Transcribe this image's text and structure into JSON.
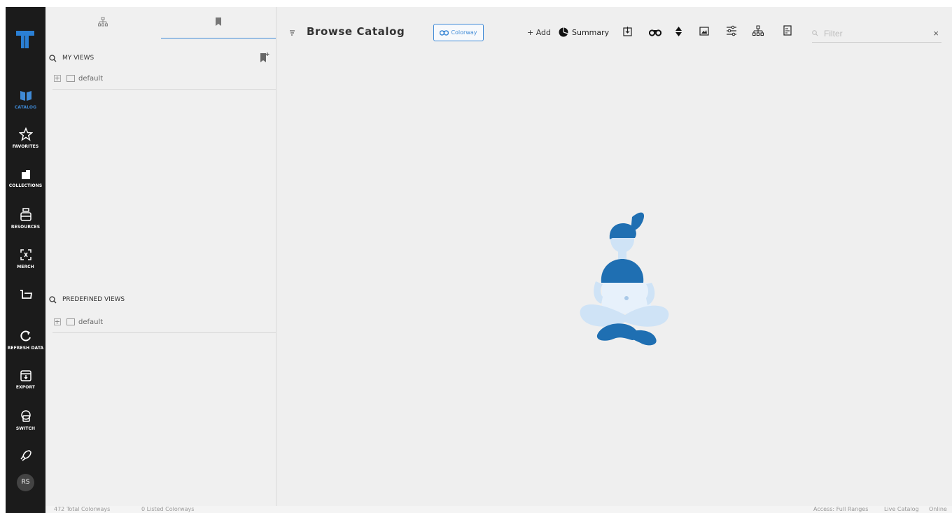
{
  "rail": {
    "items": [
      {
        "label": "CATALOG",
        "icon": "catalog-icon",
        "active": true
      },
      {
        "label": "FAVORITES",
        "icon": "star-icon"
      },
      {
        "label": "COLLECTIONS",
        "icon": "collections-icon"
      },
      {
        "label": "RESOURCES",
        "icon": "resources-icon"
      },
      {
        "label": "MERCH",
        "icon": "merch-icon"
      },
      {
        "label": "",
        "icon": "basket-icon"
      },
      {
        "label": "REFRESH DATA",
        "icon": "refresh-icon"
      },
      {
        "label": "EXPORT",
        "icon": "export-icon"
      },
      {
        "label": "SWITCH",
        "icon": "switch-icon"
      },
      {
        "label": "",
        "icon": "rocket-icon"
      }
    ],
    "avatar": "RS",
    "accent": "#3f8ad6"
  },
  "panel": {
    "my_views": {
      "title": "MY VIEWS",
      "items": [
        {
          "label": "default"
        }
      ]
    },
    "predefined_views": {
      "title": "PREDEFINED VIEWS",
      "items": [
        {
          "label": "default"
        }
      ]
    }
  },
  "toolbar": {
    "title": "Browse Catalog",
    "colorway_label": "Colorway",
    "add_label": "+ Add",
    "summary_label": "Summary",
    "filter_placeholder": "Filter",
    "close_symbol": "×"
  },
  "statusbar": {
    "total": "472 Total Colorways",
    "listed": "0 Listed Colorways",
    "access": "Access: Full Ranges",
    "catalog": "Live Catalog",
    "status": "Online"
  }
}
